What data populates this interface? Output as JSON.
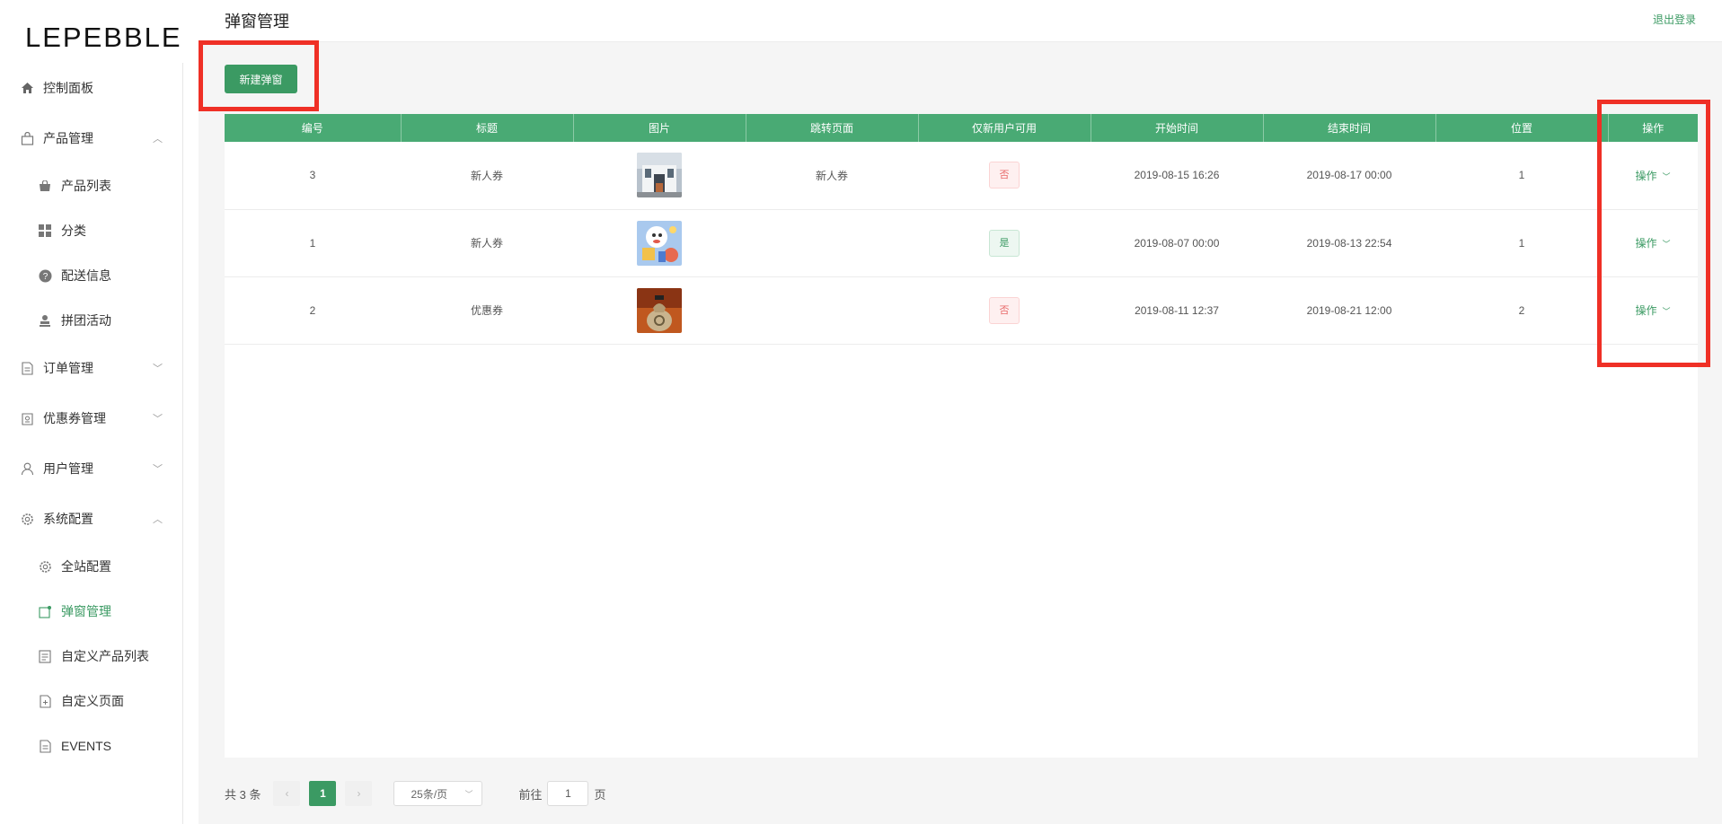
{
  "app": {
    "logo": "LEPEBBLE",
    "logout": "退出登录",
    "page_title": "弹窗管理"
  },
  "sidebar": {
    "items": [
      {
        "label": "控制面板",
        "icon": "home-icon"
      },
      {
        "label": "产品管理",
        "icon": "bag-icon",
        "expanded": true
      },
      {
        "label": "产品列表",
        "icon": "shopping-bag-icon"
      },
      {
        "label": "分类",
        "icon": "grid-icon"
      },
      {
        "label": "配送信息",
        "icon": "question-circle-icon"
      },
      {
        "label": "拼团活动",
        "icon": "user-stamp-icon"
      },
      {
        "label": "订单管理",
        "icon": "document-icon",
        "expanded": false
      },
      {
        "label": "优惠券管理",
        "icon": "coupon-icon",
        "expanded": false
      },
      {
        "label": "用户管理",
        "icon": "user-icon",
        "expanded": false
      },
      {
        "label": "系统配置",
        "icon": "gear-icon",
        "expanded": true
      },
      {
        "label": "全站配置",
        "icon": "gear-icon"
      },
      {
        "label": "弹窗管理",
        "icon": "popup-icon",
        "active": true
      },
      {
        "label": "自定义产品列表",
        "icon": "list-doc-icon"
      },
      {
        "label": "自定义页面",
        "icon": "add-doc-icon"
      },
      {
        "label": "EVENTS",
        "icon": "doc-icon"
      }
    ]
  },
  "toolbar": {
    "new_button": "新建弹窗"
  },
  "table": {
    "columns": [
      "编号",
      "标题",
      "图片",
      "跳转页面",
      "仅新用户可用",
      "开始时间",
      "结束时间",
      "位置",
      "操作"
    ],
    "rows": [
      {
        "id": "3",
        "title": "新人券",
        "image": "building-photo",
        "target": "新人券",
        "new_only": "否",
        "start": "2019-08-15 16:26",
        "end": "2019-08-17 00:00",
        "position": "1",
        "action": "操作"
      },
      {
        "id": "1",
        "title": "新人券",
        "image": "cartoon-illustration",
        "target": "",
        "new_only": "是",
        "start": "2019-08-07 00:00",
        "end": "2019-08-13 22:54",
        "position": "1",
        "action": "操作"
      },
      {
        "id": "2",
        "title": "优惠券",
        "image": "money-bag-photo",
        "target": "",
        "new_only": "否",
        "start": "2019-08-11 12:37",
        "end": "2019-08-21 12:00",
        "position": "2",
        "action": "操作"
      }
    ]
  },
  "pagination": {
    "total": "共 3 条",
    "current_page": "1",
    "page_size": "25条/页",
    "jump_prefix": "前往",
    "jump_value": "1",
    "jump_suffix": "页"
  },
  "colors": {
    "accent": "#3b9a63",
    "header": "#49aa74",
    "highlight": "#ef3026"
  }
}
